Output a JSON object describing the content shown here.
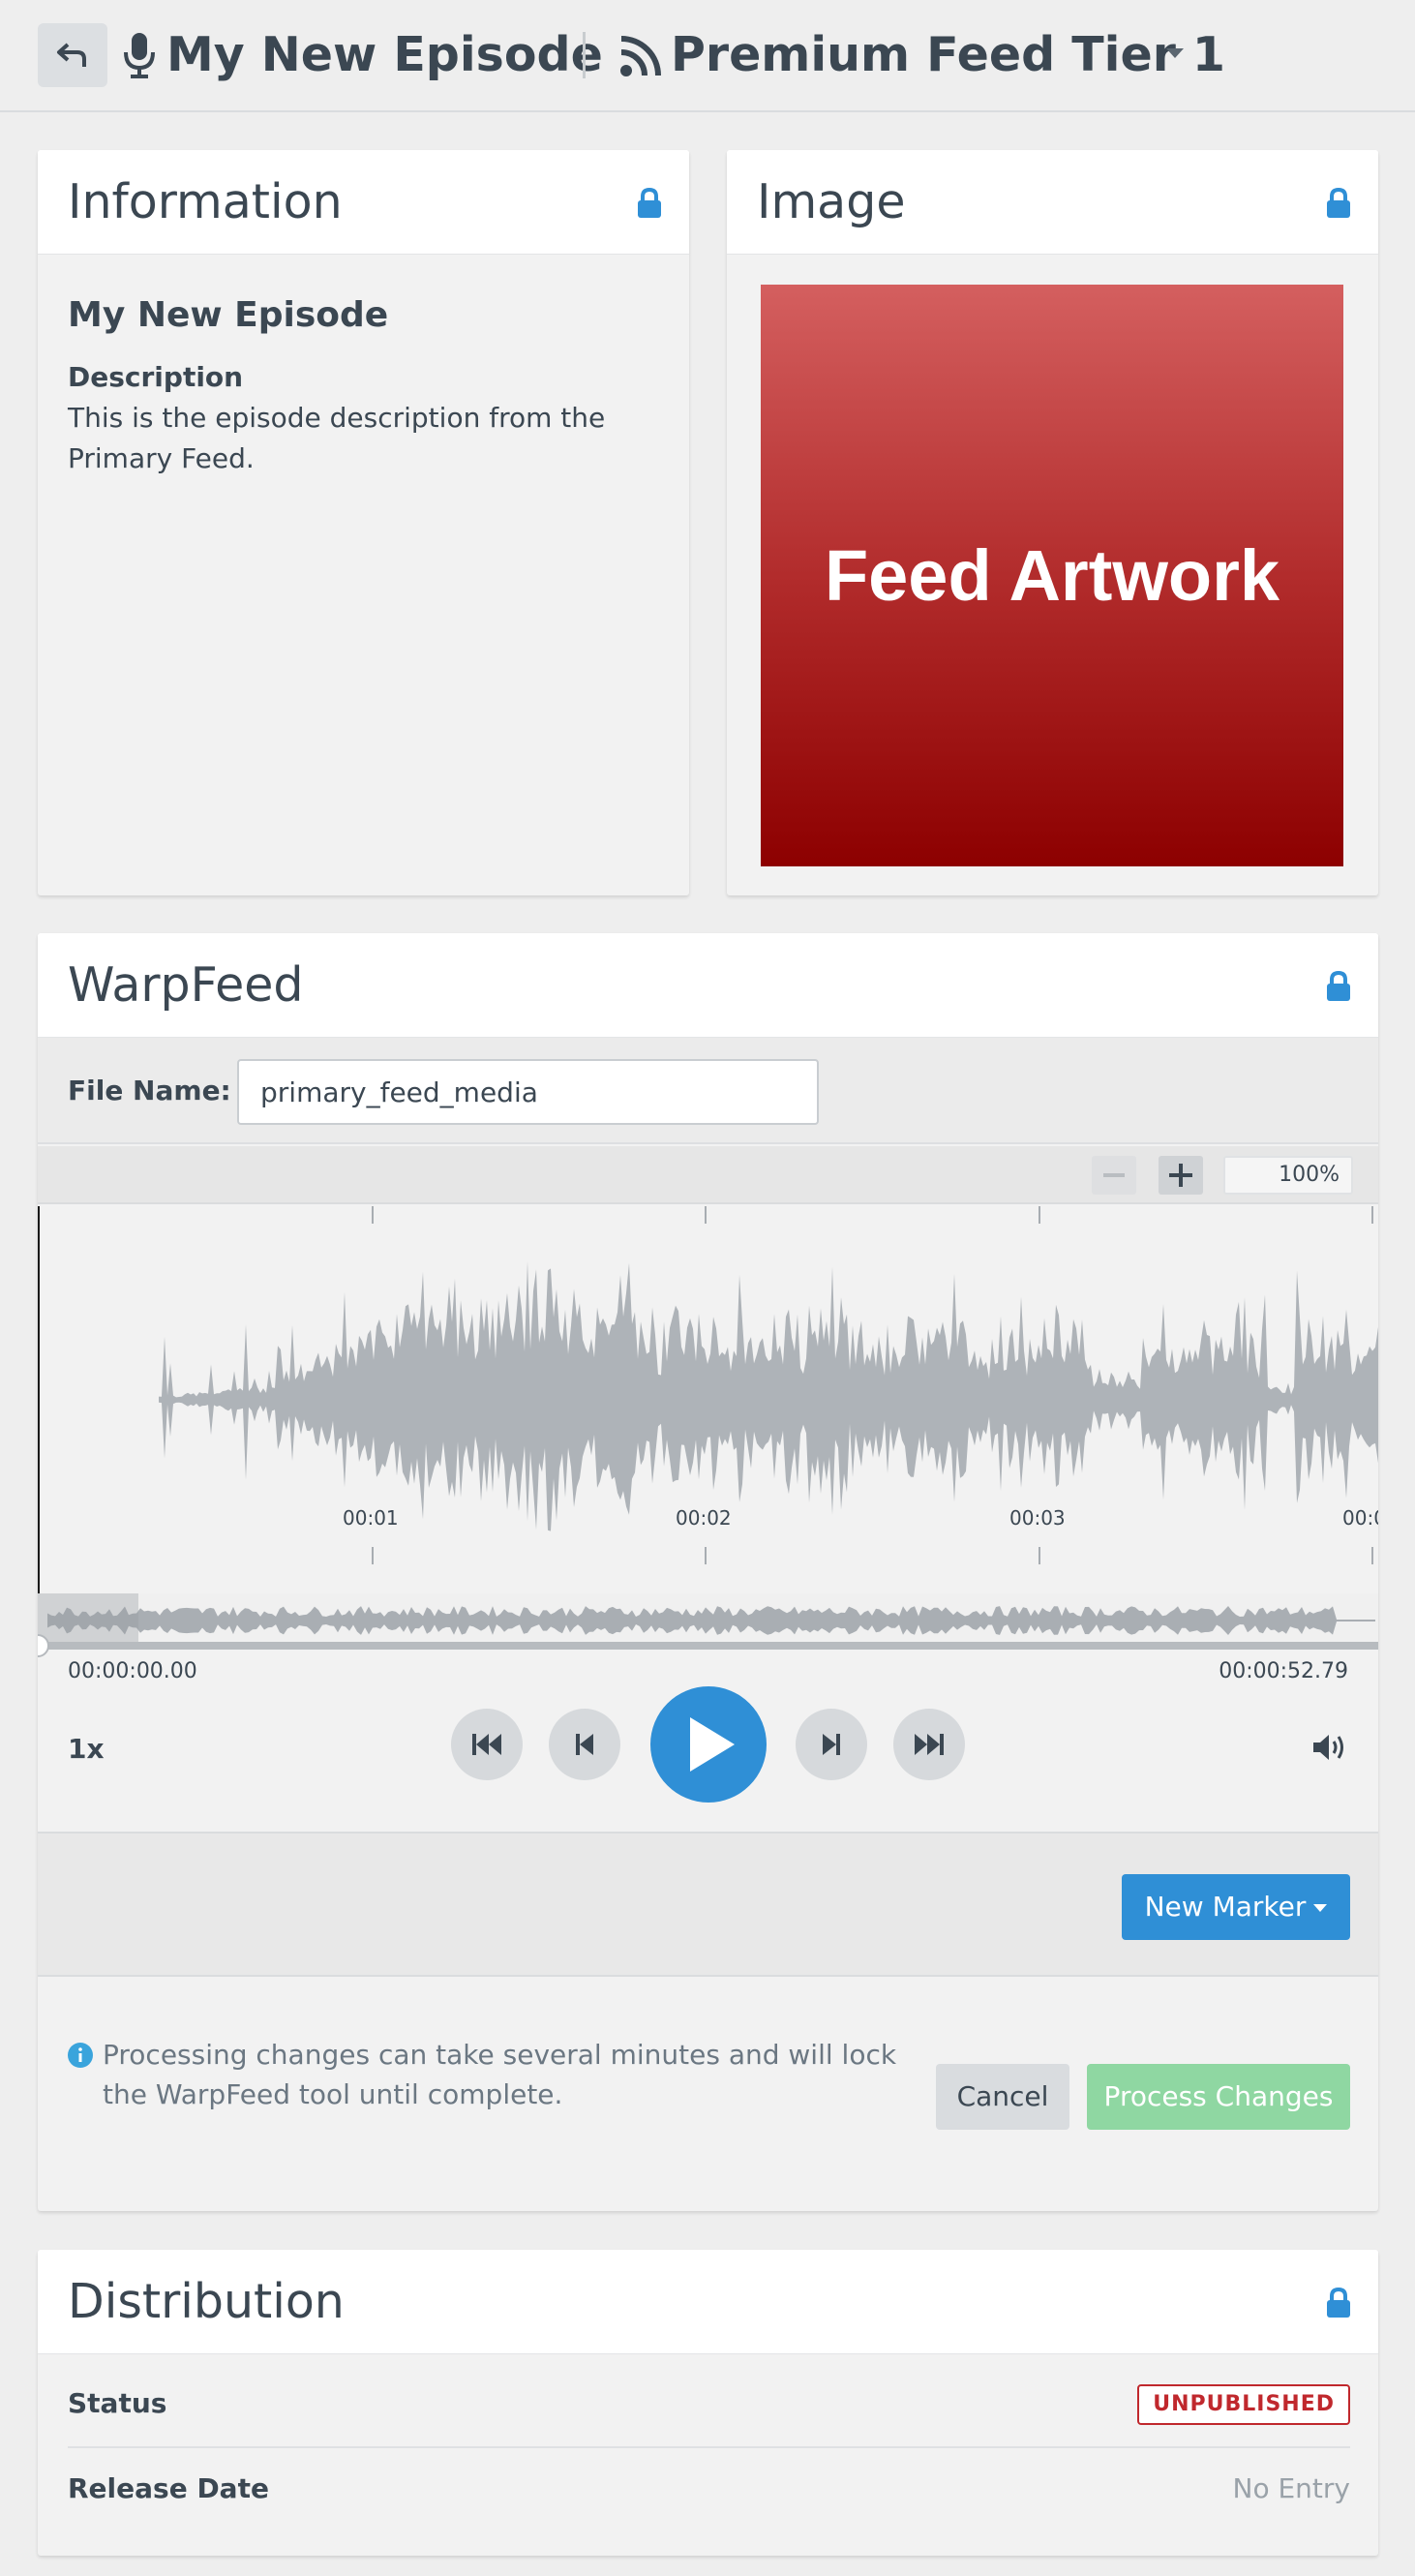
{
  "header": {
    "back_icon": "return-arrow-icon",
    "episode_icon": "microphone-icon",
    "episode_title": "My New Episode",
    "feed_icon": "rss-icon",
    "feed_title": "Premium Feed Tier 1",
    "feed_dropdown_icon": "caret-down-icon"
  },
  "information": {
    "title": "Information",
    "lock_icon": "lock-icon",
    "episode_name": "My New Episode",
    "description_label": "Description",
    "description_text": "This is the episode description from the Primary Feed."
  },
  "image": {
    "title": "Image",
    "lock_icon": "lock-icon",
    "artwork_text": "Feed Artwork",
    "artwork_colors": [
      "#d45f5f",
      "#8d0000"
    ]
  },
  "warpfeed": {
    "title": "WarpFeed",
    "lock_icon": "lock-icon",
    "file_name_label": "File Name:",
    "file_name_value": "primary_feed_media",
    "zoom_out_label": "−",
    "zoom_in_label": "+",
    "zoom_level": "100%",
    "timeline_labels": [
      "00:01",
      "00:02",
      "00:03",
      "00:0"
    ],
    "time_start": "00:00:00.00",
    "time_end": "00:00:52.79",
    "playback_speed": "1x",
    "controls": [
      "skip-to-start-icon",
      "previous-icon",
      "play-icon",
      "next-icon",
      "skip-to-end-icon"
    ],
    "volume_icon": "volume-icon",
    "new_marker_label": "New Marker",
    "info_icon": "info-circle-icon",
    "processing_note": "Processing changes can take several minutes and will lock the WarpFeed tool until complete.",
    "cancel_label": "Cancel",
    "process_label": "Process Changes",
    "accent_color": "#2f8fd6",
    "process_color": "#8fd7a2"
  },
  "distribution": {
    "title": "Distribution",
    "lock_icon": "lock-icon",
    "status_label": "Status",
    "status_value": "UNPUBLISHED",
    "status_color": "#c0282d",
    "release_date_label": "Release Date",
    "release_date_value": "No Entry"
  }
}
